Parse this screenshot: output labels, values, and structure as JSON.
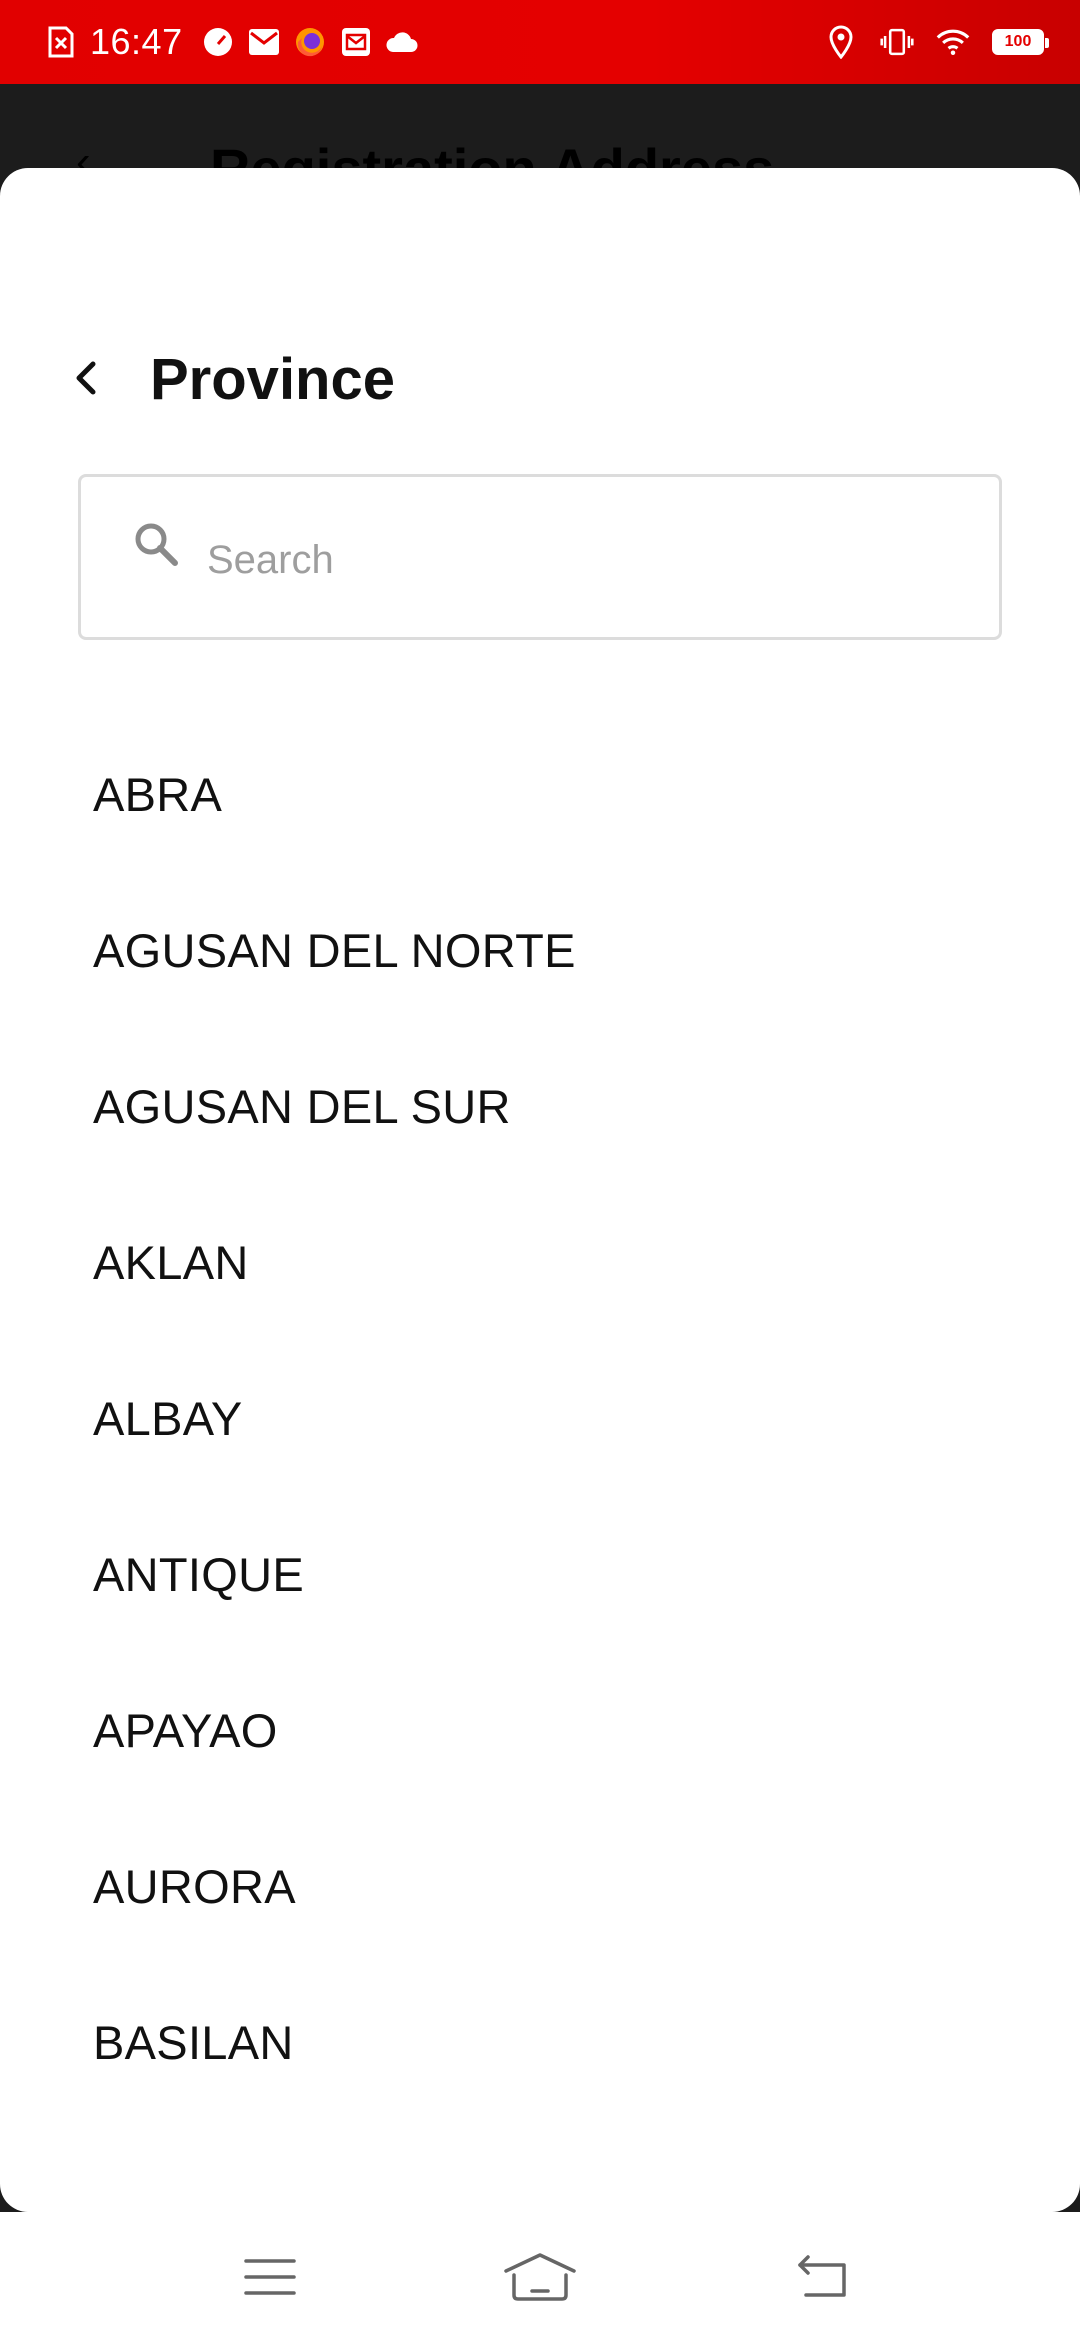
{
  "status_bar": {
    "time": "16:47",
    "notification_icons": [
      "sim-off-icon",
      "speedometer-icon",
      "mail-icon",
      "firefox-icon",
      "inbox-icon",
      "cloud-icon"
    ],
    "system_icons": [
      "location-icon",
      "vibrate-icon",
      "wifi-icon",
      "battery-icon"
    ],
    "battery_level": "100"
  },
  "background_screen": {
    "title": "Registration Address"
  },
  "sheet": {
    "title": "Province",
    "search": {
      "placeholder": "Search",
      "value": ""
    },
    "provinces": [
      "ABRA",
      "AGUSAN DEL NORTE",
      "AGUSAN DEL SUR",
      "AKLAN",
      "ALBAY",
      "ANTIQUE",
      "APAYAO",
      "AURORA",
      "BASILAN"
    ]
  },
  "nav_bar": {
    "buttons": [
      "menu-icon",
      "home-icon",
      "back-icon"
    ]
  },
  "colors": {
    "status_bar": "#e40000",
    "sheet_background": "#ffffff",
    "text_primary": "#111111",
    "placeholder": "#9e9e9e",
    "search_border": "#dcdcdc"
  }
}
